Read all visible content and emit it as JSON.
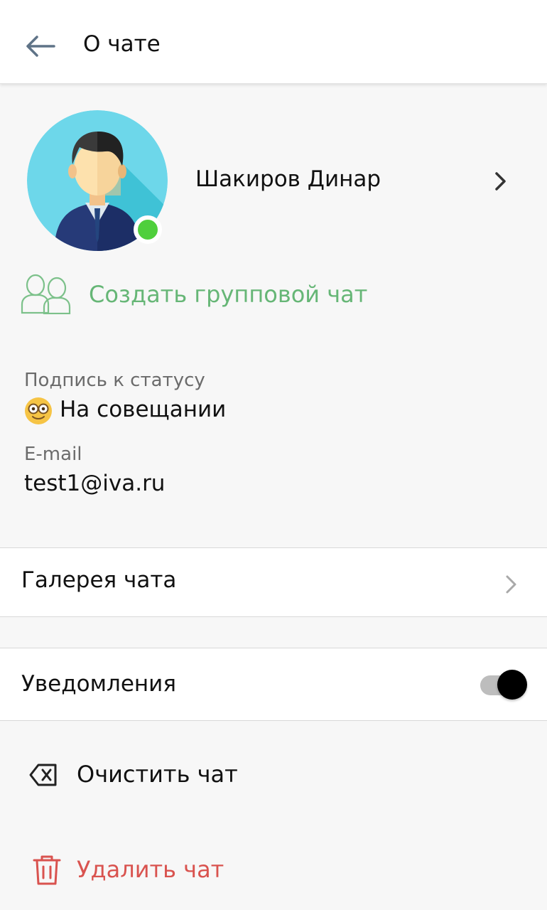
{
  "header": {
    "title": "О чате",
    "back_icon": "arrow-left-icon"
  },
  "contact": {
    "name": "Шакиров Динар",
    "status": "online",
    "status_color": "#4fcf3c"
  },
  "create_group": {
    "label": "Создать групповой чат",
    "icon": "group-users-icon",
    "color": "#66b676"
  },
  "status_caption": {
    "label": "Подпись к статусу",
    "emoji": "nerd-face-emoji",
    "value": "На совещании"
  },
  "email": {
    "label": "E-mail",
    "value": "test1@iva.ru"
  },
  "gallery": {
    "label": "Галерея чата"
  },
  "notifications": {
    "label": "Уведомления",
    "enabled": true
  },
  "actions": {
    "clear": {
      "label": "Очистить чат",
      "icon": "backspace-icon",
      "color": "#111111"
    },
    "delete": {
      "label": "Удалить чат",
      "icon": "trash-icon",
      "color": "#d9534f"
    }
  }
}
